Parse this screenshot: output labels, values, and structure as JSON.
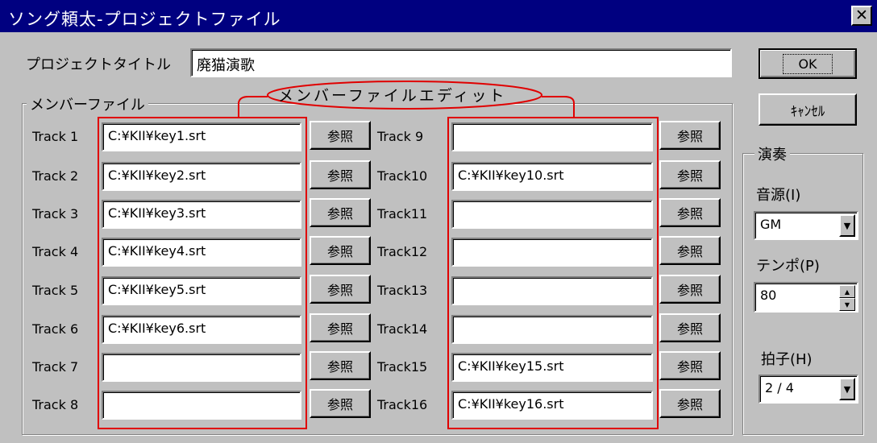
{
  "window": {
    "title": "ソング頼太-プロジェクトファイル",
    "close_glyph": "✕"
  },
  "project": {
    "title_label": "プロジェクトタイトル",
    "title_value": "廃猫演歌"
  },
  "buttons": {
    "ok": "OK",
    "cancel": "ｷｬﾝｾﾙ",
    "browse": "参照"
  },
  "members": {
    "group_label": "メンバーファイル",
    "edit_annotation": "メンバーファイルエディット",
    "tracks": [
      {
        "label": "Track 1",
        "file": "C:¥KII¥key1.srt"
      },
      {
        "label": "Track 2",
        "file": "C:¥KII¥key2.srt"
      },
      {
        "label": "Track 3",
        "file": "C:¥KII¥key3.srt"
      },
      {
        "label": "Track 4",
        "file": "C:¥KII¥key4.srt"
      },
      {
        "label": "Track 5",
        "file": "C:¥KII¥key5.srt"
      },
      {
        "label": "Track 6",
        "file": "C:¥KII¥key6.srt"
      },
      {
        "label": "Track 7",
        "file": ""
      },
      {
        "label": "Track 8",
        "file": ""
      },
      {
        "label": "Track 9",
        "file": ""
      },
      {
        "label": "Track10",
        "file": "C:¥KII¥key10.srt"
      },
      {
        "label": "Track11",
        "file": ""
      },
      {
        "label": "Track12",
        "file": ""
      },
      {
        "label": "Track13",
        "file": ""
      },
      {
        "label": "Track14",
        "file": ""
      },
      {
        "label": "Track15",
        "file": "C:¥KII¥key15.srt"
      },
      {
        "label": "Track16",
        "file": "C:¥KII¥key16.srt"
      }
    ]
  },
  "performance": {
    "group_label": "演奏",
    "source_label": "音源(I)",
    "source_value": "GM",
    "tempo_label": "テンポ(P)",
    "tempo_value": "80",
    "meter_label": "拍子(H)",
    "meter_value": "2 / 4"
  },
  "annotation_color": "#e00000",
  "title_bar_color": "#000080"
}
